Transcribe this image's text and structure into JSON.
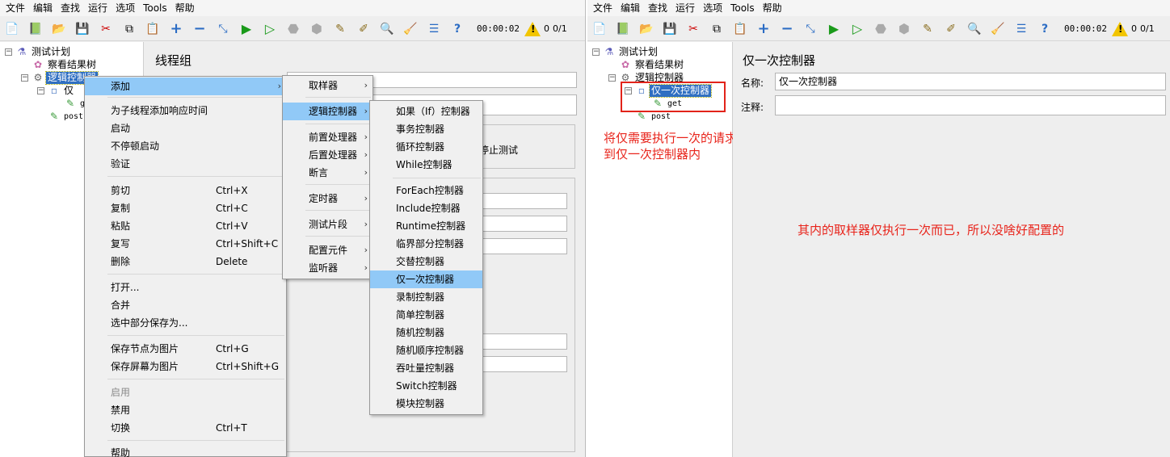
{
  "menubar": {
    "items": [
      "文件",
      "编辑",
      "查找",
      "运行",
      "选项",
      "Tools",
      "帮助"
    ]
  },
  "toolbar": {
    "icons": [
      "new-icon",
      "templates-icon",
      "open-icon",
      "save-icon",
      "cut-icon",
      "copy-icon",
      "paste-icon",
      "expand-icon",
      "collapse-icon",
      "toggle-icon",
      "start-icon",
      "start-no-pause-icon",
      "stop-icon",
      "shutdown-icon",
      "clear-icon",
      "clear-all-icon",
      "search-icon",
      "reset-search-icon",
      "function-helper-icon",
      "help-icon"
    ],
    "timer": "00:00:02",
    "warn_count": "0",
    "threads": "0/1"
  },
  "left": {
    "tree": {
      "root": "测试计划",
      "results_tree": "察看结果树",
      "logic": "逻辑控制器",
      "once": "仅",
      "child": "g",
      "post": "post"
    },
    "panel": {
      "title": "线程组",
      "partial_text": "停止测试"
    }
  },
  "context_menu": {
    "items": [
      {
        "label": "添加",
        "shortcut": "",
        "submenu": true,
        "highlight": true
      },
      {
        "label": "为子线程添加响应时间",
        "shortcut": ""
      },
      {
        "label": "启动",
        "shortcut": ""
      },
      {
        "label": "不停顿启动",
        "shortcut": ""
      },
      {
        "label": "验证",
        "shortcut": ""
      },
      {
        "label": "剪切",
        "shortcut": "Ctrl+X"
      },
      {
        "label": "复制",
        "shortcut": "Ctrl+C"
      },
      {
        "label": "粘贴",
        "shortcut": "Ctrl+V"
      },
      {
        "label": "复写",
        "shortcut": "Ctrl+Shift+C"
      },
      {
        "label": "删除",
        "shortcut": "Delete"
      },
      {
        "label": "打开...",
        "shortcut": ""
      },
      {
        "label": "合并",
        "shortcut": ""
      },
      {
        "label": "选中部分保存为...",
        "shortcut": ""
      },
      {
        "label": "保存节点为图片",
        "shortcut": "Ctrl+G"
      },
      {
        "label": "保存屏幕为图片",
        "shortcut": "Ctrl+Shift+G"
      },
      {
        "label": "启用",
        "shortcut": "",
        "disabled": true
      },
      {
        "label": "禁用",
        "shortcut": ""
      },
      {
        "label": "切换",
        "shortcut": "Ctrl+T"
      },
      {
        "label": "帮助",
        "shortcut": ""
      }
    ]
  },
  "add_submenu": {
    "items": [
      "取样器",
      "逻辑控制器",
      "前置处理器",
      "后置处理器",
      "断言",
      "定时器",
      "测试片段",
      "配置元件",
      "监听器"
    ]
  },
  "logic_submenu": {
    "items": [
      "如果（If）控制器",
      "事务控制器",
      "循环控制器",
      "While控制器",
      "ForEach控制器",
      "Include控制器",
      "Runtime控制器",
      "临界部分控制器",
      "交替控制器",
      "仅一次控制器",
      "录制控制器",
      "简单控制器",
      "随机控制器",
      "随机顺序控制器",
      "吞吐量控制器",
      "Switch控制器",
      "模块控制器"
    ]
  },
  "right": {
    "tree": {
      "root": "测试计划",
      "results_tree": "察看结果树",
      "logic": "逻辑控制器",
      "once": "仅一次控制器",
      "get": "get",
      "post": "post"
    },
    "panel": {
      "title": "仅一次控制器",
      "name_label": "名称:",
      "name_value": "仅一次控制器",
      "comment_label": "注释:",
      "comment_value": ""
    },
    "annotation_move": [
      "将仅需要执行一次的请求移动",
      "到仅一次控制器内"
    ],
    "annotation_note": "其内的取样器仅执行一次而已，所以没啥好配置的"
  },
  "colors": {
    "selection": "#2f6fc2",
    "menu_highlight": "#91c9f7",
    "annotation": "#e8231a"
  }
}
